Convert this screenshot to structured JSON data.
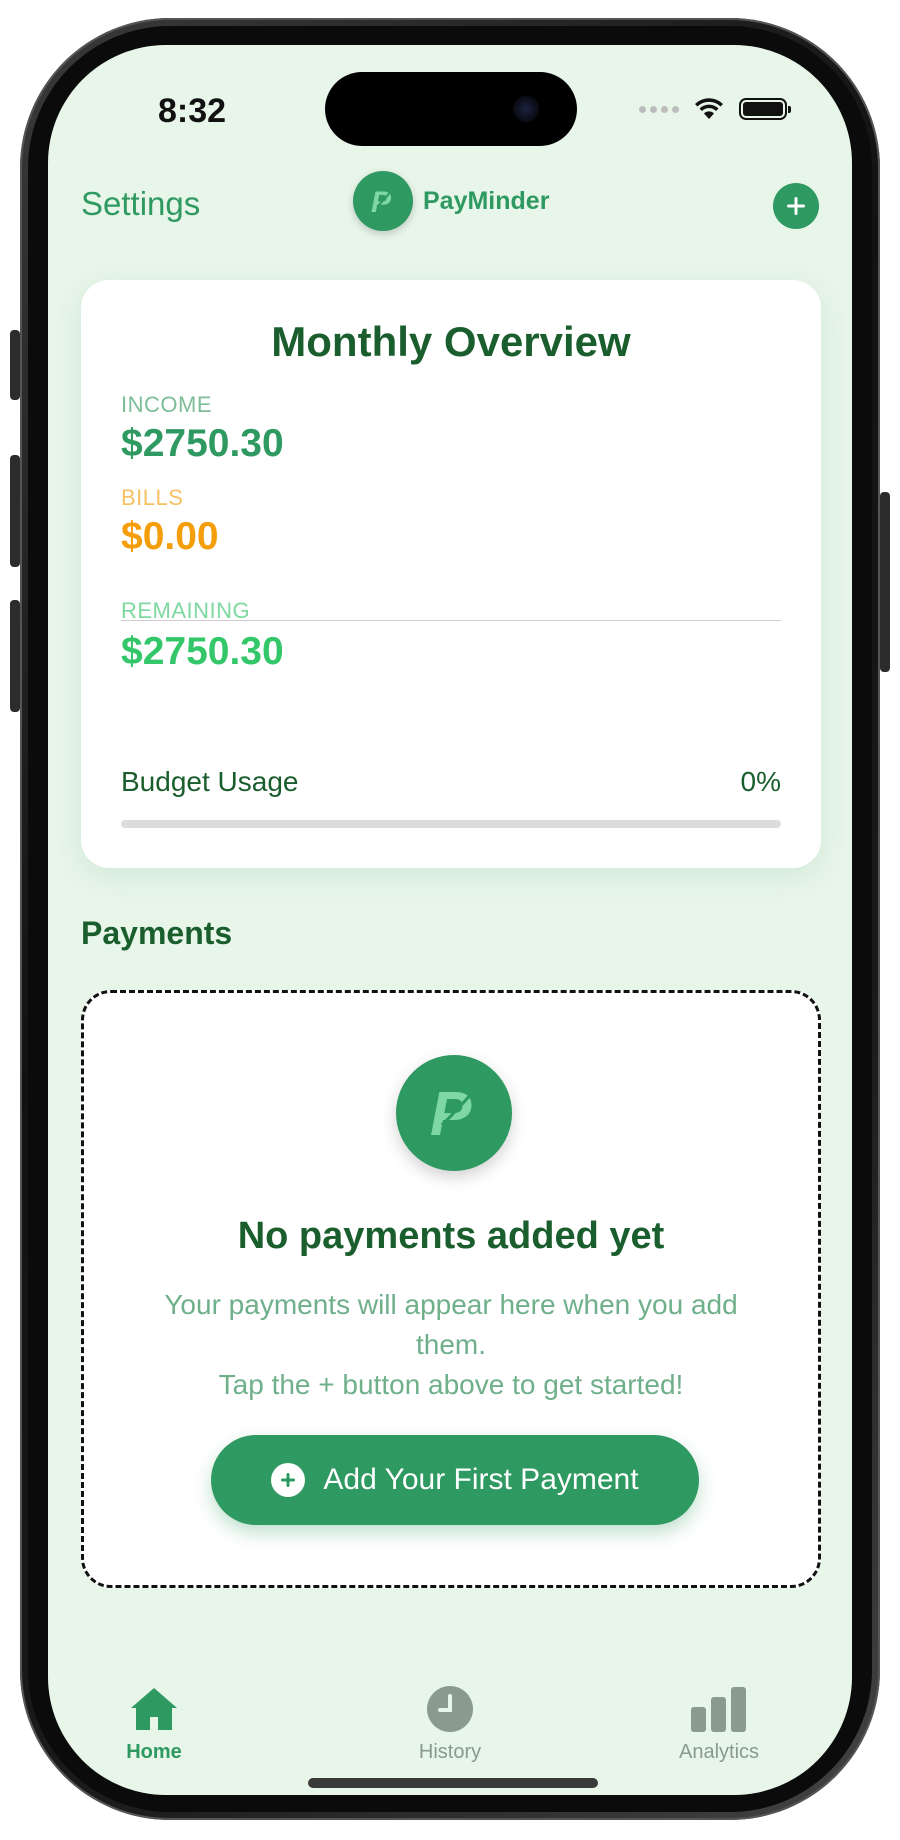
{
  "status_bar": {
    "time": "8:32"
  },
  "header": {
    "settings_label": "Settings",
    "app_name": "PayMinder",
    "logo_letter": "P",
    "add_icon": "plus-circle-icon"
  },
  "overview": {
    "title": "Monthly Overview",
    "income_label": "INCOME",
    "income_value": "$2750.30",
    "bills_label": "BILLS",
    "bills_value": "$0.00",
    "remaining_label": "REMAINING",
    "remaining_value": "$2750.30",
    "budget_usage_label": "Budget Usage",
    "budget_usage_percent": "0%",
    "budget_usage_fraction": 0
  },
  "payments": {
    "heading": "Payments",
    "empty_title": "No payments added yet",
    "empty_line_1": "Your payments will appear here when you add them.",
    "empty_line_2": "Tap the + button above to get started!",
    "add_button_label": "Add Your First Payment"
  },
  "tabs": [
    {
      "label": "Home",
      "icon": "home-icon",
      "active": true
    },
    {
      "label": "History",
      "icon": "clock-icon",
      "active": false
    },
    {
      "label": "Analytics",
      "icon": "bar-chart-icon",
      "active": false
    }
  ],
  "colors": {
    "primary": "#2e9960",
    "dark_green": "#1b5e2e",
    "background": "#e8f5e9",
    "income": "#2e9960",
    "bills": "#f59e0b",
    "remaining": "#34c76a",
    "inactive_tab": "#8a9a8e"
  }
}
